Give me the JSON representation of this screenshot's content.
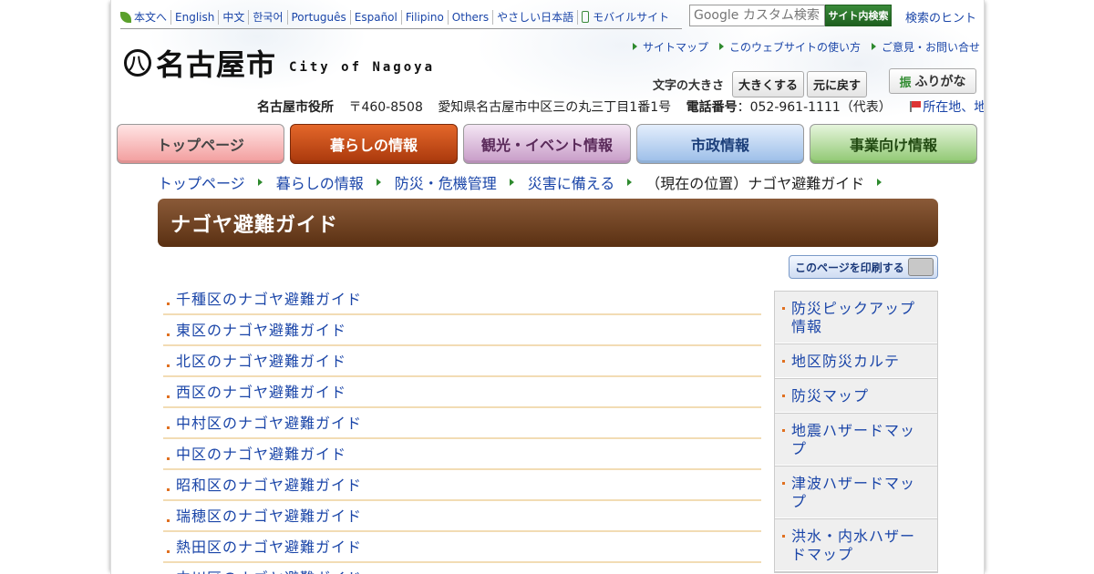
{
  "langbar": {
    "items": [
      "本文へ",
      "English",
      "中文",
      "한국어",
      "Português",
      "Español",
      "Filipino",
      "Others",
      "やさしい日本語",
      "モバイルサイト"
    ]
  },
  "search": {
    "placeholder": "Google カスタム検索",
    "button_label": "サイト内検索",
    "hint_label": "検索のヒント"
  },
  "logo": {
    "text": "名古屋市",
    "sub": "City of Nagoya"
  },
  "toplinks": [
    "サイトマップ",
    "このウェブサイトの使い方",
    "ご意見・お問い合せ"
  ],
  "fontsize": {
    "label": "文字の大きさ",
    "larger": "大きくする",
    "reset": "元に戻す"
  },
  "furigana": {
    "icon": "振",
    "label": "ふりがな"
  },
  "address": {
    "office": "名古屋市役所",
    "postal": "〒460-8508",
    "street": "愛知県名古屋市中区三の丸三丁目1番1号",
    "phone_label": "電話番号",
    "phone": "：052-961-1111（代表）",
    "map_link": "所在地、地図"
  },
  "nav": [
    "トップページ",
    "暮らしの情報",
    "観光・イベント情報",
    "市政情報",
    "事業向け情報"
  ],
  "breadcrumb": {
    "items": [
      "トップページ",
      "暮らしの情報",
      "防災・危機管理",
      "災害に備える"
    ],
    "current": "（現在の位置）ナゴヤ避難ガイド"
  },
  "page_title": "ナゴヤ避難ガイド",
  "print_label": "このページを印刷する",
  "main_list": [
    "千種区のナゴヤ避難ガイド",
    "東区のナゴヤ避難ガイド",
    "北区のナゴヤ避難ガイド",
    "西区のナゴヤ避難ガイド",
    "中村区のナゴヤ避難ガイド",
    "中区のナゴヤ避難ガイド",
    "昭和区のナゴヤ避難ガイド",
    "瑞穂区のナゴヤ避難ガイド",
    "熱田区のナゴヤ避難ガイド",
    "中川区のナゴヤ避難ガイド"
  ],
  "sidebar": [
    "防災ピックアップ情報",
    "地区防災カルテ",
    "防災マップ",
    "地震ハザードマップ",
    "津波ハザードマップ",
    "洪水・内水ハザードマップ"
  ],
  "colors": {
    "title_bar": "#6b3f1e",
    "active_tab": "#c04a14",
    "link": "#1a45a8",
    "accent_green": "#2e8a2e"
  }
}
